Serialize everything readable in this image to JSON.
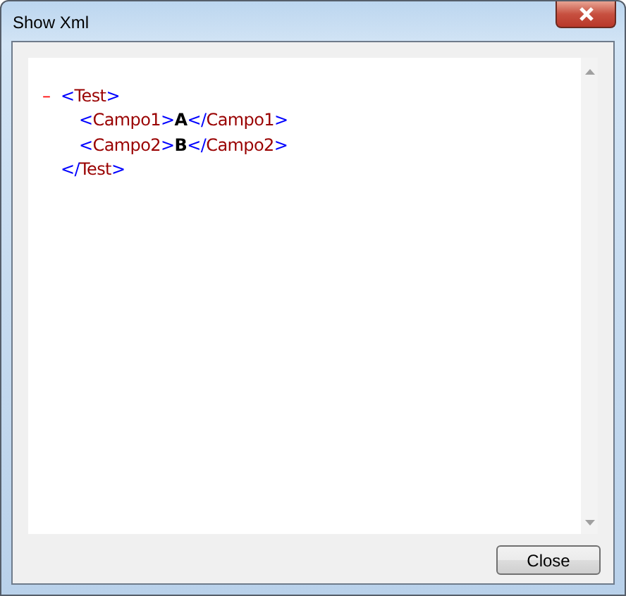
{
  "window": {
    "title": "Show Xml"
  },
  "xml_view": {
    "root": {
      "toggle": "–",
      "expanded": true,
      "open_tag": [
        {
          "kind": "markup",
          "text": "<"
        },
        {
          "kind": "name",
          "text": "Test"
        },
        {
          "kind": "markup",
          "text": ">"
        }
      ],
      "children": [
        {
          "tokens": [
            {
              "kind": "markup",
              "text": "<"
            },
            {
              "kind": "name",
              "text": "Campo1"
            },
            {
              "kind": "markup",
              "text": ">"
            },
            {
              "kind": "value",
              "text": "A"
            },
            {
              "kind": "markup",
              "text": "</"
            },
            {
              "kind": "name",
              "text": "Campo1"
            },
            {
              "kind": "markup",
              "text": ">"
            }
          ]
        },
        {
          "tokens": [
            {
              "kind": "markup",
              "text": "<"
            },
            {
              "kind": "name",
              "text": "Campo2"
            },
            {
              "kind": "markup",
              "text": ">"
            },
            {
              "kind": "value",
              "text": "B"
            },
            {
              "kind": "markup",
              "text": "</"
            },
            {
              "kind": "name",
              "text": "Campo2"
            },
            {
              "kind": "markup",
              "text": ">"
            }
          ]
        }
      ],
      "close_tag": [
        {
          "kind": "markup",
          "text": "</"
        },
        {
          "kind": "name",
          "text": "Test"
        },
        {
          "kind": "markup",
          "text": ">"
        }
      ]
    }
  },
  "buttons": [
    {
      "label": "Close"
    }
  ]
}
